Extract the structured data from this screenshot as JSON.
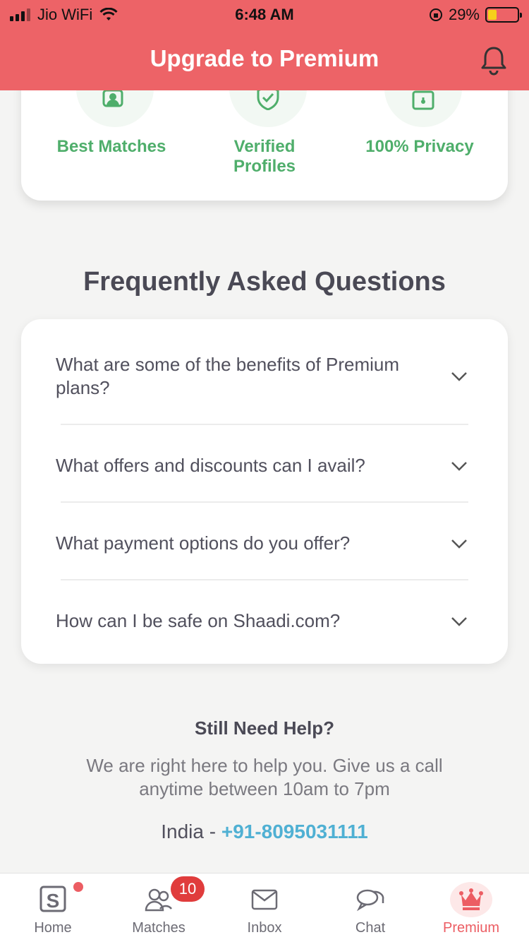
{
  "status_bar": {
    "carrier": "Jio WiFi",
    "time": "6:48 AM",
    "battery": "29%",
    "battery_level": 0.29
  },
  "header": {
    "title": "Upgrade to Premium",
    "bell_icon": "bell-icon"
  },
  "features": [
    {
      "label": "Best Matches",
      "icon": "matches-icon"
    },
    {
      "label": "Verified Profiles",
      "icon": "shield-check-icon"
    },
    {
      "label": "100% Privacy",
      "icon": "lock-icon"
    }
  ],
  "faq": {
    "title": "Frequently Asked Questions",
    "items": [
      {
        "question": "What are some of the benefits of Premium plans?"
      },
      {
        "question": "What offers and discounts can I avail?"
      },
      {
        "question": "What payment options do you offer?"
      },
      {
        "question": "How can I be safe on Shaadi.com?"
      }
    ]
  },
  "help": {
    "title": "Still Need Help?",
    "text": "We are right here to help you. Give us a call anytime between 10am to 7pm",
    "country": "India - ",
    "phone": "+91-8095031111"
  },
  "bottom_nav": {
    "items": [
      {
        "label": "Home",
        "icon": "home-icon",
        "has_dot": true
      },
      {
        "label": "Matches",
        "icon": "matches-icon",
        "badge": "10"
      },
      {
        "label": "Inbox",
        "icon": "envelope-icon"
      },
      {
        "label": "Chat",
        "icon": "chat-icon"
      },
      {
        "label": "Premium",
        "icon": "crown-icon",
        "active": true
      }
    ]
  },
  "colors": {
    "header_bg": "#ed6367",
    "feature_green": "#4fae6b",
    "phone_blue": "#4fb0d3",
    "active_tab": "#ec5d63",
    "badge_red": "#e03c3c"
  }
}
